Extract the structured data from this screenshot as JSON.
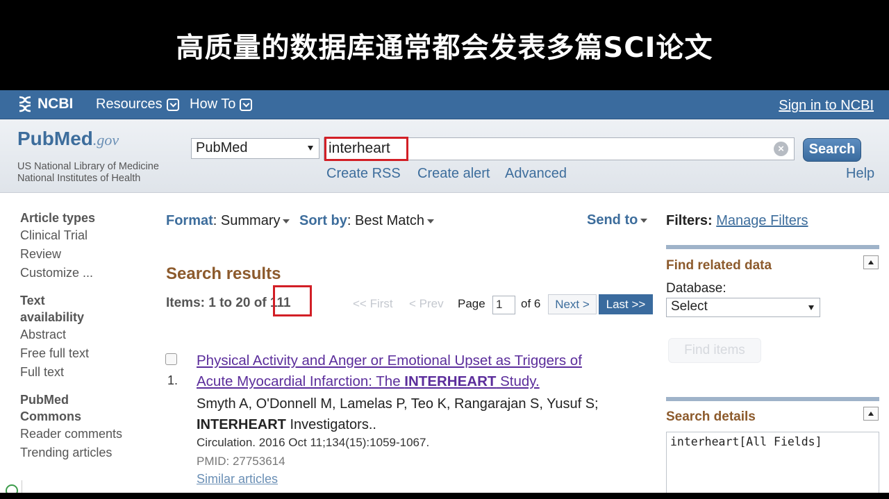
{
  "banner": {
    "title": "高质量的数据库通常都会发表多篇SCI论文"
  },
  "ncbi_bar": {
    "logo": "NCBI",
    "resources": "Resources",
    "howto": "How To",
    "signin": "Sign in to NCBI"
  },
  "search": {
    "logo_pub": "Pub",
    "logo_med": "Med",
    "logo_gov": ".gov",
    "lib_line1": "US National Library of Medicine",
    "lib_line2": "National Institutes of Health",
    "database": "PubMed",
    "term": "interheart",
    "button": "Search",
    "links": {
      "rss": "Create RSS",
      "alert": "Create alert",
      "advanced": "Advanced",
      "help": "Help"
    }
  },
  "sidebar": {
    "article_types": {
      "heading": "Article types",
      "items": [
        "Clinical Trial",
        "Review",
        "Customize ..."
      ]
    },
    "text_availability": {
      "heading_line1": "Text",
      "heading_line2": "availability",
      "items": [
        "Abstract",
        "Free full text",
        "Full text"
      ]
    },
    "pubmed_commons": {
      "heading_line1": "PubMed",
      "heading_line2": "Commons",
      "items": [
        "Reader comments",
        "Trending articles"
      ]
    }
  },
  "toolbar": {
    "format_label": "Format",
    "format_value": ": Summary",
    "sort_label": "Sort by",
    "sort_value": ": Best Match",
    "send_to": "Send to"
  },
  "results": {
    "title": "Search results",
    "items_prefix": "Items: 1 to 20 of ",
    "total": "111",
    "pager": {
      "first": "<< First",
      "prev": "< Prev",
      "page_label": "Page",
      "page_value": "1",
      "of": "of 6",
      "next": "Next >",
      "last": "Last >>"
    },
    "list": [
      {
        "number": "1.",
        "title_line1": "Physical Activity and Anger or Emotional Upset as Triggers of",
        "title_line2_pre": "Acute Myocardial Infarction: The ",
        "title_line2_bold": "INTERHEART",
        "title_line2_post": " Study.",
        "authors_line1": "Smyth A, O'Donnell M, Lamelas P, Teo K, Rangarajan S, Yusuf S;",
        "authors_bold": "INTERHEART",
        "authors_line2_post": " Investigators..",
        "journal": "Circulation. 2016 Oct 11;134(15):1059-1067.",
        "pmid": "PMID: 27753614",
        "similar": "Similar articles"
      }
    ]
  },
  "right": {
    "filters_label": "Filters:",
    "manage_filters": "Manage Filters",
    "related_heading": "Find related data",
    "database_label": "Database:",
    "database_select": "Select",
    "find_items": "Find items",
    "details_heading": "Search details",
    "details_query": "interheart[All Fields]"
  },
  "colors": {
    "ncbi_blue": "#3a6b9e",
    "highlight_red": "#d21f26",
    "heading_brown": "#8c5a2c",
    "visited_link": "#5b2d9b"
  }
}
